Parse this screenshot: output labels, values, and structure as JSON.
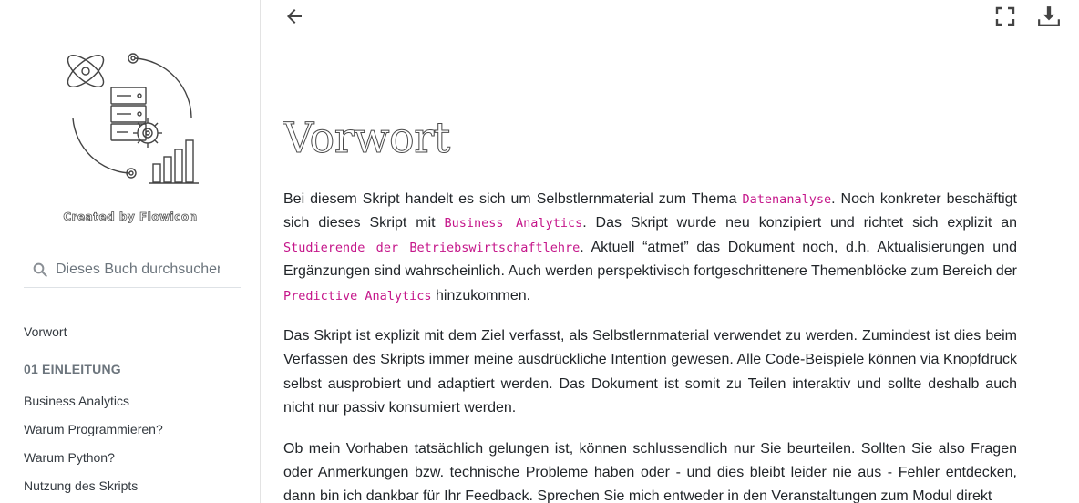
{
  "sidebar": {
    "logo_caption": "Created by Flowicon",
    "search_placeholder": "Dieses Buch durchsuchen",
    "toc": {
      "preface": "Vorwort",
      "chapter_1": "01 EINLEITUNG",
      "items": [
        "Business Analytics",
        "Warum Programmieren?",
        "Warum Python?",
        "Nutzung des Skripts"
      ]
    }
  },
  "toolbar": {
    "back_icon": "arrow-left-icon",
    "fullscreen_icon": "fullscreen-icon",
    "download_icon": "download-icon"
  },
  "main": {
    "title": "Vorwort",
    "p1": {
      "t1": "Bei diesem Skript handelt es sich um Selbstlernmaterial zum Thema ",
      "c1": "Datenanalyse",
      "t2": ". Noch konkreter beschäftigt sich dieses Skript mit ",
      "c2": "Business Analytics",
      "t3": ". Das Skript wurde neu konzipiert und richtet sich explizit an ",
      "c3": "Studierende der Betriebswirtschaftlehre",
      "t4": ". Aktuell “atmet” das Dokument noch, d.h. Aktualisierungen und Ergänzungen sind wahrscheinlich. Auch werden perspektivisch fortgeschrittenere Themenblöcke zum Bereich der ",
      "c4": "Predictive Analytics",
      "t5": " hinzukommen."
    },
    "p2": "Das Skript ist explizit mit dem Ziel verfasst, als Selbstlernmaterial verwendet zu werden. Zumindest ist dies beim Verfassen des Skripts immer meine ausdrückliche Intention gewesen. Alle Code-Beispiele können via Knopfdruck selbst ausprobiert und adaptiert werden. Das Dokument ist somit zu Teilen interaktiv und sollte deshalb auch nicht nur passiv konsumiert werden.",
    "p3": "Ob mein Vorhaben tatsächlich gelungen ist, können schlussendlich nur Sie beurteilen. Sollten Sie also Fragen oder Anmerkungen bzw. technische Probleme haben oder - und dies bleibt leider nie aus - Fehler entdecken, dann bin ich dankbar für Ihr Feedback. Sprechen Sie mich entweder in den Veranstaltungen zum Modul direkt"
  },
  "colors": {
    "code": "#c5168a",
    "text": "#212529",
    "muted": "#6c757d"
  }
}
